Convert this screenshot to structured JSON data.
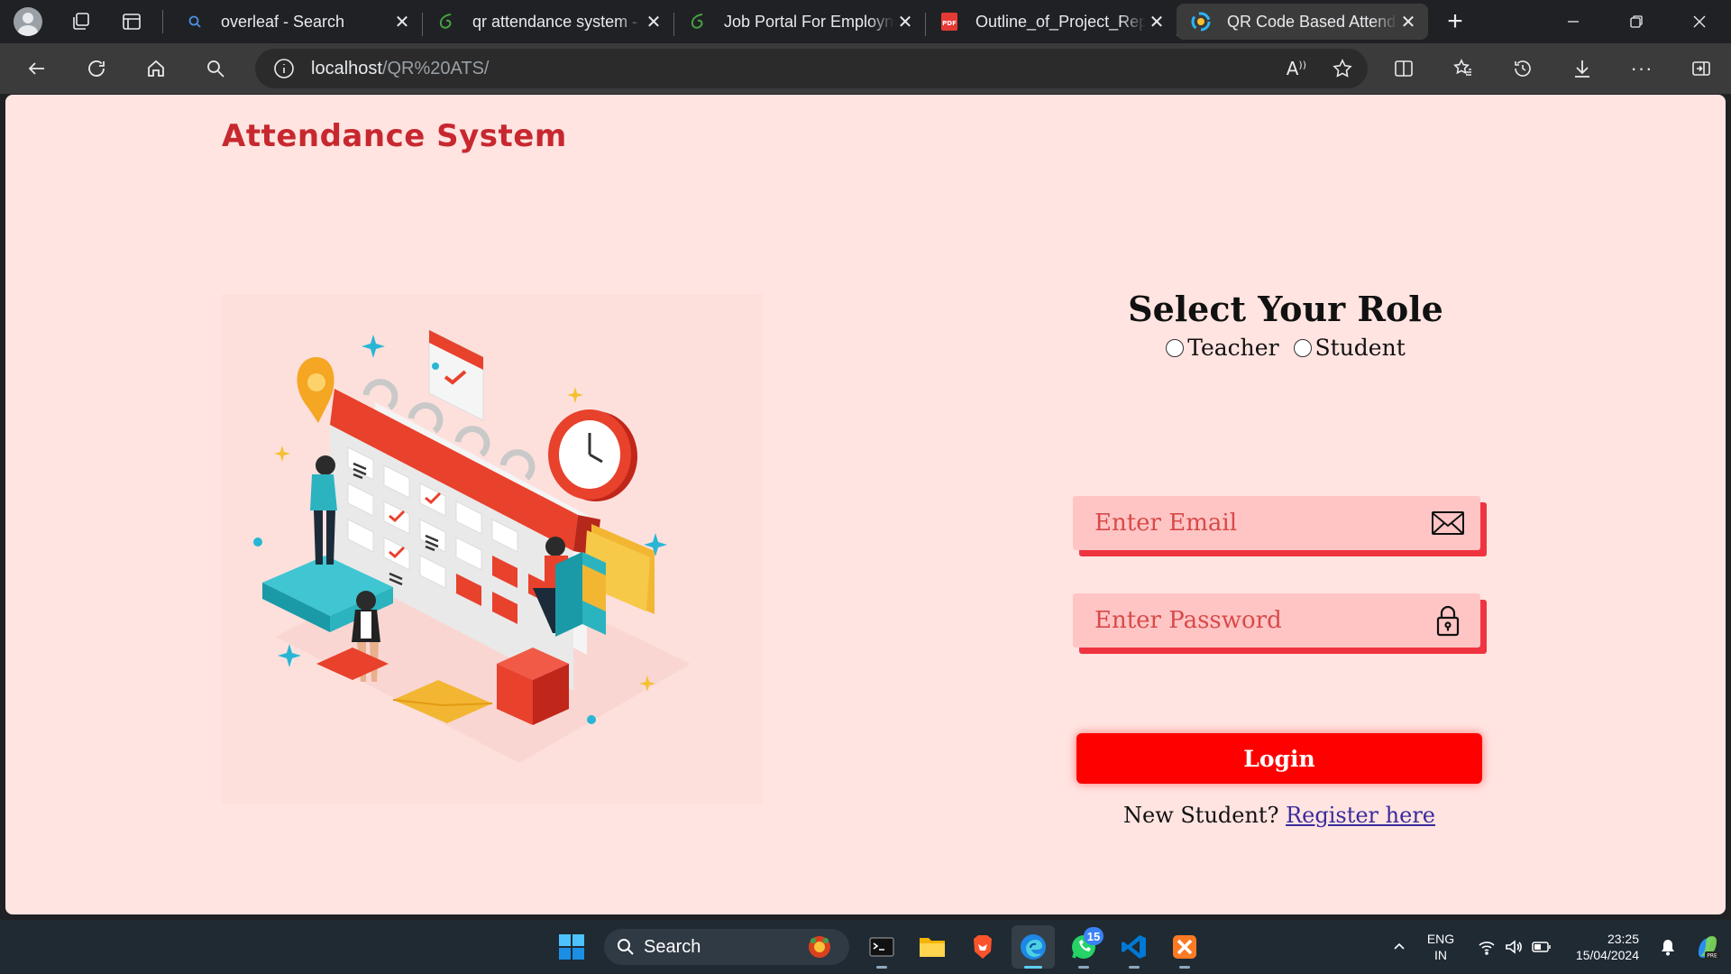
{
  "browser": {
    "tabs": [
      {
        "title": "overleaf - Search",
        "icon": "search-icon",
        "active": false
      },
      {
        "title": "qr attendance system -",
        "icon": "overleaf-leaf-icon",
        "active": false
      },
      {
        "title": "Job Portal For Employn",
        "icon": "overleaf-leaf-icon",
        "active": false
      },
      {
        "title": "Outline_of_Project_Rep",
        "icon": "pdf-icon",
        "active": false
      },
      {
        "title": "QR Code Based Attend",
        "icon": "site-favicon",
        "active": true
      }
    ],
    "address": {
      "host": "localhost",
      "path": "/QR%20ATS/"
    }
  },
  "page": {
    "brand": "Attendance System",
    "role_title": "Select Your Role",
    "roles": [
      "Teacher",
      "Student"
    ],
    "email_placeholder": "Enter Email",
    "password_placeholder": "Enter Password",
    "login_label": "Login",
    "register_prompt": "New Student?",
    "register_link": "Register here",
    "colors": {
      "background": "#ffe4e1",
      "brand": "#c7282f",
      "field": "#ffc5c5",
      "accent": "#ef3340",
      "button": "#ff0000"
    }
  },
  "taskbar": {
    "search_label": "Search",
    "whatsapp_badge": "15",
    "lang_line1": "ENG",
    "lang_line2": "IN",
    "time": "23:25",
    "date": "15/04/2024"
  }
}
